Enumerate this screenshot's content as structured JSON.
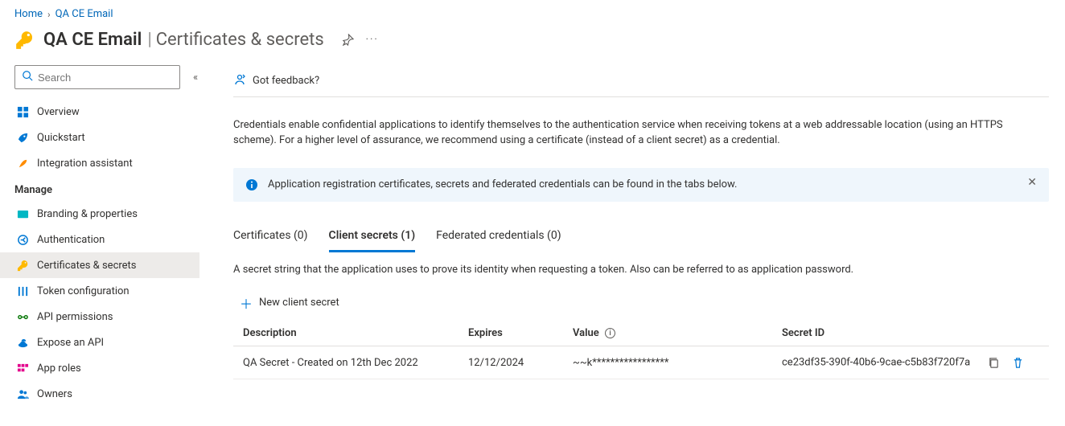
{
  "breadcrumb": {
    "home": "Home",
    "current": "QA CE Email"
  },
  "header": {
    "app_name": "QA CE Email",
    "section": "Certificates & secrets"
  },
  "search": {
    "placeholder": "Search"
  },
  "sidebar": {
    "overview": "Overview",
    "quickstart": "Quickstart",
    "integration": "Integration assistant",
    "manage_header": "Manage",
    "branding": "Branding & properties",
    "authentication": "Authentication",
    "certificates": "Certificates & secrets",
    "token_config": "Token configuration",
    "api_permissions": "API permissions",
    "expose_api": "Expose an API",
    "app_roles": "App roles",
    "owners": "Owners"
  },
  "toolbar": {
    "feedback": "Got feedback?"
  },
  "content": {
    "description": "Credentials enable confidential applications to identify themselves to the authentication service when receiving tokens at a web addressable location (using an HTTPS scheme). For a higher level of assurance, we recommend using a certificate (instead of a client secret) as a credential.",
    "banner": "Application registration certificates, secrets and federated credentials can be found in the tabs below.",
    "tabs": {
      "certificates": "Certificates (0)",
      "client_secrets": "Client secrets (1)",
      "federated": "Federated credentials (0)"
    },
    "tab_desc": "A secret string that the application uses to prove its identity when requesting a token. Also can be referred to as application password.",
    "new_secret": "New client secret",
    "table": {
      "headers": {
        "description": "Description",
        "expires": "Expires",
        "value": "Value",
        "secret_id": "Secret ID"
      },
      "rows": [
        {
          "description": "QA Secret - Created on 12th Dec 2022",
          "expires": "12/12/2024",
          "value": "~~k*****************",
          "secret_id": "ce23df35-390f-40b6-9cae-c5b83f720f7a"
        }
      ]
    }
  }
}
